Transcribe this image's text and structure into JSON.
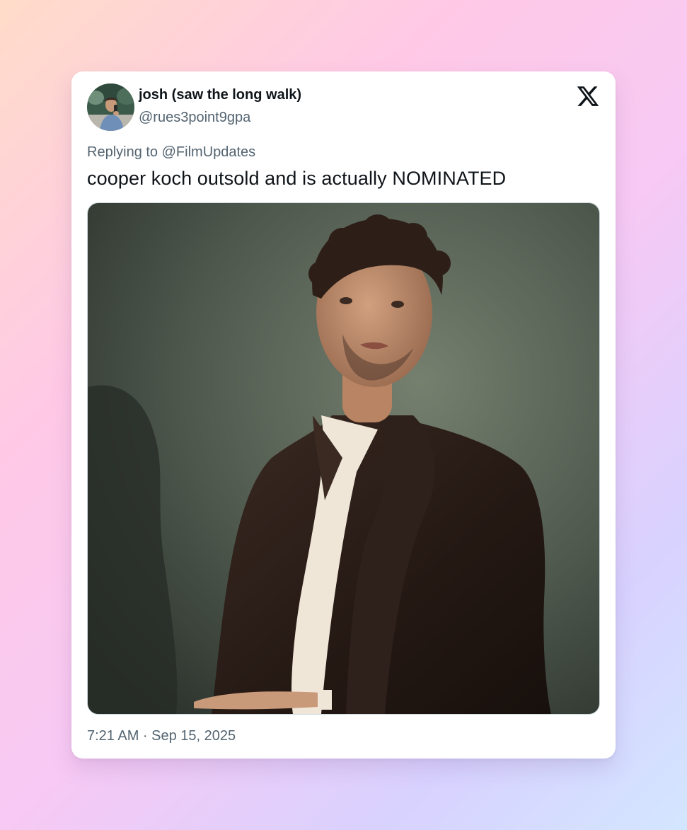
{
  "tweet": {
    "author": {
      "display_name": "josh (saw the long walk)",
      "handle": "@rues3point9gpa"
    },
    "reply": {
      "prefix": "Replying to ",
      "handle": "@FilmUpdates"
    },
    "text": "cooper koch outsold and is actually NOMINATED",
    "timestamp": "7:21 AM · Sep 15, 2025",
    "media_description": "portrait photo"
  },
  "icons": {
    "brand": "x-logo-icon"
  },
  "colors": {
    "text_primary": "#0f1419",
    "text_secondary": "#536471",
    "card_background": "#ffffff"
  }
}
